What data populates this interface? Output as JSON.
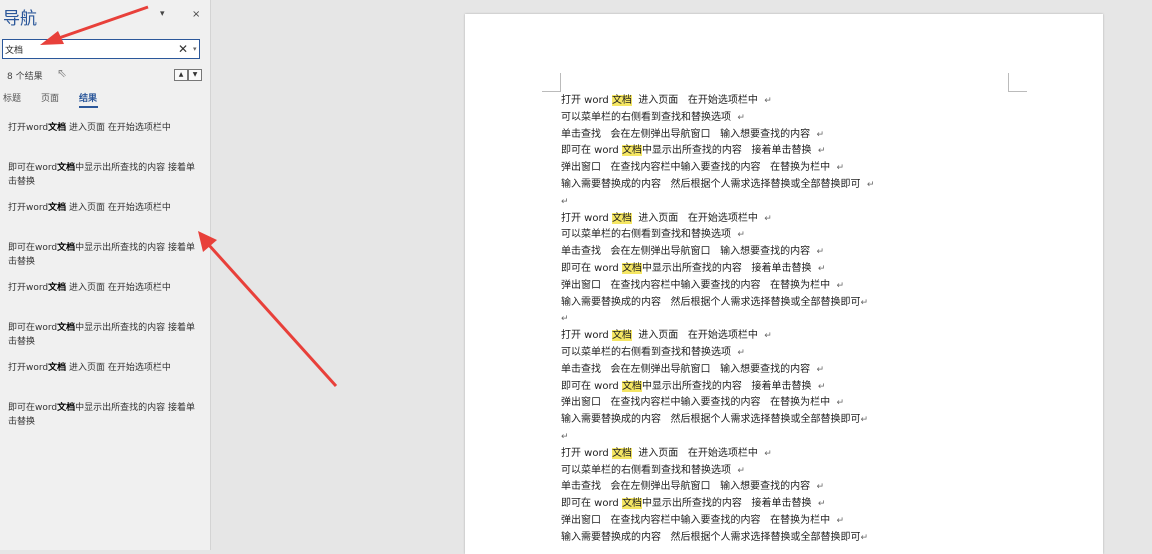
{
  "nav": {
    "title": "导航",
    "menu_glyph": "▾",
    "close_glyph": "×",
    "search_value": "文档",
    "clear_glyph": "✕",
    "dropdown_glyph": "▾",
    "result_count": "8 个结果",
    "prev_glyph": "▲",
    "next_glyph": "▼",
    "tabs": [
      {
        "label": "标题",
        "active": false
      },
      {
        "label": "页面",
        "active": false
      },
      {
        "label": "结果",
        "active": true
      }
    ],
    "results": [
      {
        "pre": "打开word",
        "kw": "文档",
        "post": " 进入页面  在开始选项栏中"
      },
      {
        "pre": "即可在word",
        "kw": "文档",
        "post": "中显示出所查找的内容 接着单击替换"
      },
      {
        "pre": "打开word",
        "kw": "文档",
        "post": " 进入页面  在开始选项栏中"
      },
      {
        "pre": "即可在word",
        "kw": "文档",
        "post": "中显示出所查找的内容 接着单击替换"
      },
      {
        "pre": "打开word",
        "kw": "文档",
        "post": " 进入页面  在开始选项栏中"
      },
      {
        "pre": "即可在word",
        "kw": "文档",
        "post": "中显示出所查找的内容 接着单击替换"
      },
      {
        "pre": "打开word",
        "kw": "文档",
        "post": " 进入页面  在开始选项栏中"
      },
      {
        "pre": "即可在word",
        "kw": "文档",
        "post": "中显示出所查找的内容 接着单击替换"
      }
    ]
  },
  "document": {
    "keyword": "文档",
    "paragraph_mark": "↵",
    "paragraphs": [
      {
        "lines": [
          "打开 word 文档  进入页面   在开始选项栏中  ",
          "可以菜单栏的右侧看到查找和替换选项  ",
          "单击查找   会在左侧弹出导航窗口   输入想要查找的内容  ",
          "即可在 word 文档中显示出所查找的内容   接着单击替换  ",
          "弹出窗口   在查找内容栏中输入要查找的内容   在替换为栏中  ",
          "输入需要替换成的内容   然后根据个人需求选择替换或全部替换即可  ",
          ""
        ]
      },
      {
        "lines": [
          "打开 word 文档  进入页面   在开始选项栏中  ",
          "可以菜单栏的右侧看到查找和替换选项  ",
          "单击查找   会在左侧弹出导航窗口   输入想要查找的内容  ",
          "即可在 word 文档中显示出所查找的内容   接着单击替换  ",
          "弹出窗口   在查找内容栏中输入要查找的内容   在替换为栏中  ",
          "输入需要替换成的内容   然后根据个人需求选择替换或全部替换即可",
          ""
        ]
      },
      {
        "lines": [
          "打开 word 文档  进入页面   在开始选项栏中  ",
          "可以菜单栏的右侧看到查找和替换选项  ",
          "单击查找   会在左侧弹出导航窗口   输入想要查找的内容  ",
          "即可在 word 文档中显示出所查找的内容   接着单击替换  ",
          "弹出窗口   在查找内容栏中输入要查找的内容   在替换为栏中  ",
          "输入需要替换成的内容   然后根据个人需求选择替换或全部替换即可",
          ""
        ]
      },
      {
        "lines": [
          "打开 word 文档  进入页面   在开始选项栏中  ",
          "可以菜单栏的右侧看到查找和替换选项  ",
          "单击查找   会在左侧弹出导航窗口   输入想要查找的内容  ",
          "即可在 word 文档中显示出所查找的内容   接着单击替换  ",
          "弹出窗口   在查找内容栏中输入要查找的内容   在替换为栏中  ",
          "输入需要替换成的内容   然后根据个人需求选择替换或全部替换即可"
        ]
      }
    ]
  },
  "colors": {
    "accent": "#2b579a",
    "highlight": "#f5e663",
    "arrow": "#e8403a"
  }
}
